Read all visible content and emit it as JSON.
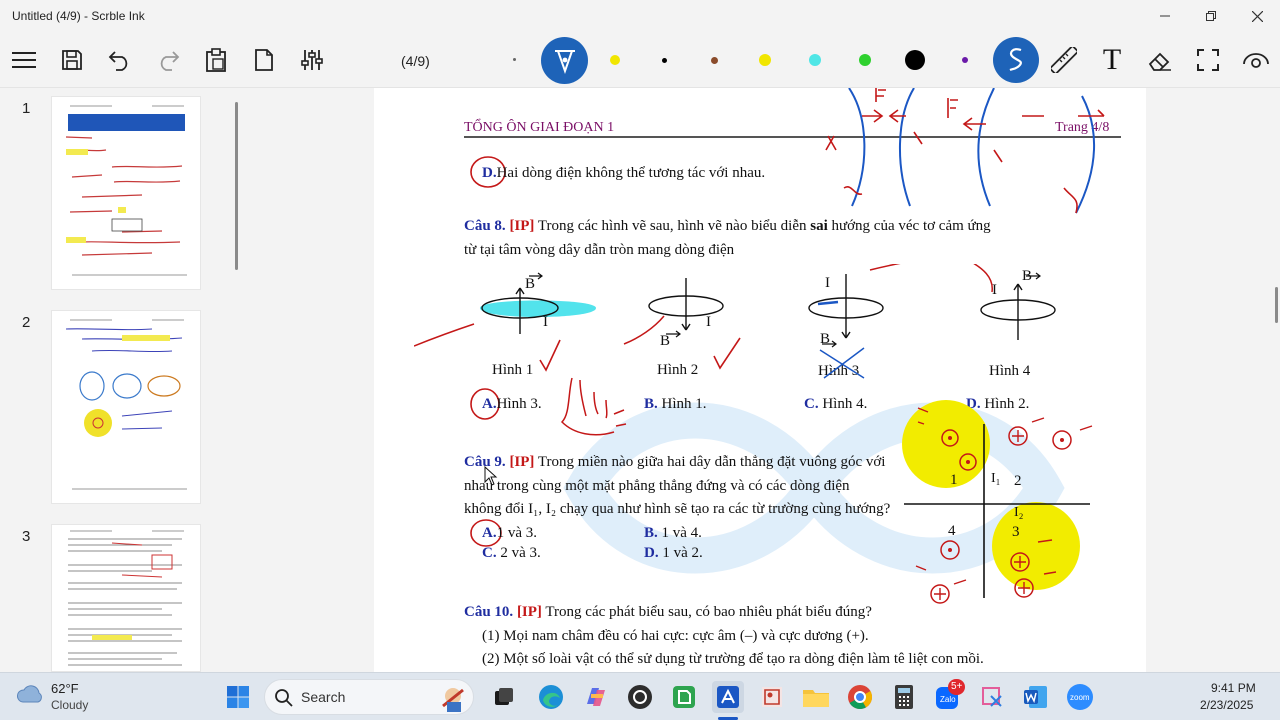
{
  "window": {
    "title": "Untitled (4/9) - Scrble Ink",
    "minimize_icon": "minimize-icon",
    "restore_icon": "restore-icon",
    "close_icon": "close-icon"
  },
  "toolbar": {
    "page_indicator": "(4/9)",
    "icons": [
      "menu-icon",
      "save-icon",
      "undo-icon",
      "redo-icon",
      "clipboard-icon",
      "new-page-icon",
      "settings-sliders-icon",
      "pen-icon",
      "lasso-icon",
      "ruler-icon",
      "text-icon",
      "eraser-icon",
      "select-icon",
      "view-icon"
    ],
    "text_tool": "T",
    "colors": [
      "#f1e600",
      "#000000",
      "#8a4b2a",
      "#f1e600",
      "#4fe6e6",
      "#2fd12f",
      "#000000",
      "#6a1aa8"
    ]
  },
  "sidebar": {
    "pages": [
      {
        "number": "1"
      },
      {
        "number": "2"
      },
      {
        "number": "3"
      }
    ]
  },
  "document": {
    "header_left": "TỔNG ÔN GIAI ĐOẠN 1",
    "header_right": "Trang 4/8",
    "option_d_prev": {
      "letter": "D.",
      "text": "Hai dòng điện không thể tương tác với nhau."
    },
    "q8": {
      "label": "Câu 8.",
      "tag": "[IP]",
      "text1": "Trong các hình vẽ sau, hình vẽ nào biểu diễn",
      "bold": "sai",
      "text2": "hướng của véc tơ cảm ứng",
      "line2": "từ tại tâm vòng dây dẫn tròn mang dòng điện",
      "figures": [
        "Hình 1",
        "Hình 2",
        "Hình 3",
        "Hình 4"
      ],
      "options": [
        {
          "letter": "A.",
          "text": "Hình 3."
        },
        {
          "letter": "B.",
          "text": "Hình 1."
        },
        {
          "letter": "C.",
          "text": "Hình 4."
        },
        {
          "letter": "D.",
          "text": "Hình 2."
        }
      ]
    },
    "q9": {
      "label": "Câu 9.",
      "tag": "[IP]",
      "line1": "Trong miền nào giữa hai dây dẫn thẳng đặt vuông góc với",
      "line2": "nhau trong cùng một mặt phẳng thẳng đứng và có các dòng điện",
      "line3": "không đổi I₁, I₂ chạy qua như hình sẽ tạo ra các từ trường cùng hướng?",
      "options": [
        {
          "letter": "A.",
          "text": "1 và 3."
        },
        {
          "letter": "B.",
          "text": "1 và 4."
        },
        {
          "letter": "C.",
          "text": "2 và 3."
        },
        {
          "letter": "D.",
          "text": "1 và 2."
        }
      ],
      "regions": [
        "1",
        "2",
        "3",
        "4"
      ],
      "i1": "I₁",
      "i2": "I₂"
    },
    "q10": {
      "label": "Câu 10.",
      "tag": "[IP]",
      "text": "Trong các phát biểu sau, có bao nhiêu phát biểu đúng?",
      "s1": "(1) Mọi nam châm đều có hai cực: cực âm (–) và cực dương (+).",
      "s2": "(2) Một số loài vật có thể sử dụng từ trường để tạo ra dòng điện làm tê liệt con mồi."
    },
    "fig_labels": {
      "B": "B",
      "I": "I"
    }
  },
  "taskbar": {
    "weather": {
      "temp": "62°F",
      "condition": "Cloudy"
    },
    "search_placeholder": "Search",
    "clock": {
      "time": "9:41 PM",
      "date": "2/23/2025"
    },
    "zalo_badge": "5+"
  }
}
